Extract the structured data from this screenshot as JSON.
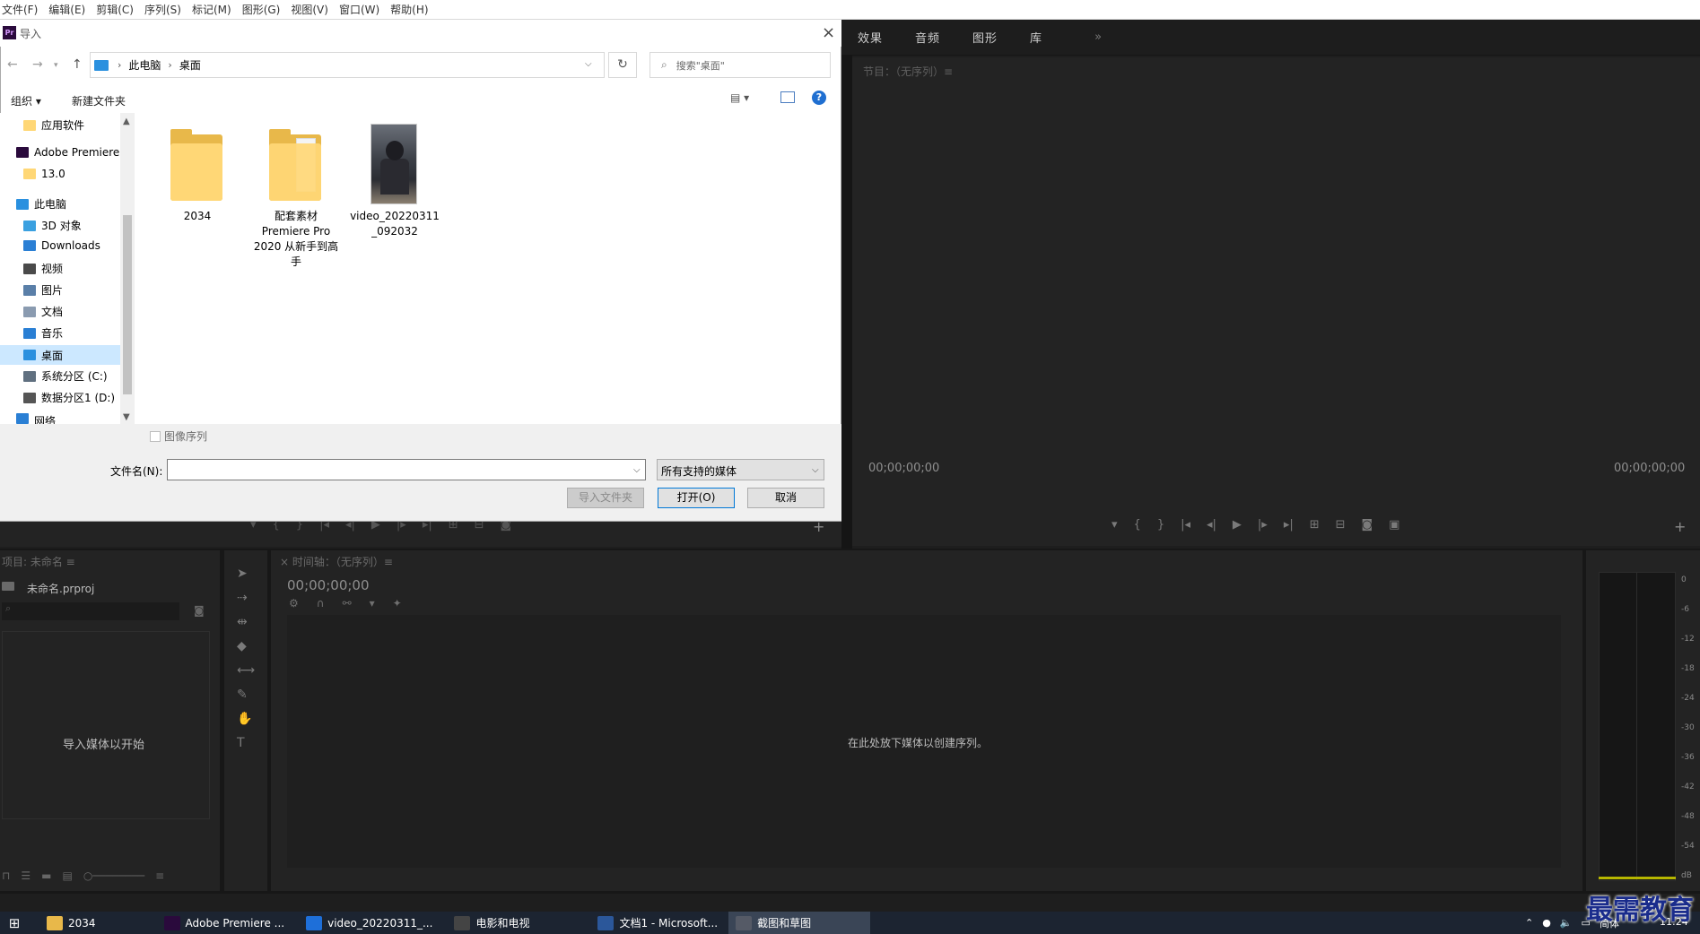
{
  "menubar": {
    "items": [
      "文件(F)",
      "编辑(E)",
      "剪辑(C)",
      "序列(S)",
      "标记(M)",
      "图形(G)",
      "视图(V)",
      "窗口(W)",
      "帮助(H)"
    ]
  },
  "premiere": {
    "right_tabs": [
      "效果",
      "音频",
      "图形",
      "库"
    ],
    "more_tabs": "»",
    "program_title": "节目：（无序列）≡",
    "program_tc_left": "00;00;00;00",
    "program_tc_right": "00;00;00;00",
    "plus": "+",
    "project_title": "项目: 未命名 ≡",
    "project_file": "未命名.prproj",
    "project_empty": "导入媒体以开始",
    "timeline_title": "×  时间轴：（无序列）≡",
    "timeline_tc": "00;00;00;00",
    "timeline_empty": "在此处放下媒体以创建序列。",
    "meter_db": [
      "0",
      "-6",
      "-12",
      "-18",
      "-24",
      "-30",
      "-36",
      "-42",
      "-48",
      "-54",
      "dB"
    ]
  },
  "dialog": {
    "title": "导入",
    "app_logo": "Pr",
    "close": "×",
    "address": {
      "crumbs": [
        "此电脑",
        "桌面"
      ],
      "sep": "›",
      "refresh": "↻"
    },
    "search": {
      "placeholder": "搜索\"桌面\""
    },
    "toolbar": {
      "organize": "组织 ▾",
      "new_folder": "新建文件夹",
      "view": "▤ ▾",
      "help": "?"
    },
    "nav": [
      {
        "label": "应用软件",
        "icon": "folder-icon",
        "color": "#ffd776"
      },
      {
        "label": "Adobe Premiere",
        "icon": "premiere-icon",
        "color": "#2a0a3c"
      },
      {
        "label": "13.0",
        "icon": "folder-icon",
        "color": "#ffd776"
      },
      {
        "label": "此电脑",
        "icon": "pc-icon",
        "color": "#2a90df"
      },
      {
        "label": "3D 对象",
        "icon": "3d-objects-icon",
        "color": "#3aa0e0"
      },
      {
        "label": "Downloads",
        "icon": "download-icon",
        "color": "#2a7fd4"
      },
      {
        "label": "视频",
        "icon": "video-icon",
        "color": "#4a4a4a"
      },
      {
        "label": "图片",
        "icon": "pictures-icon",
        "color": "#5a7fa8"
      },
      {
        "label": "文档",
        "icon": "documents-icon",
        "color": "#8a9bb0"
      },
      {
        "label": "音乐",
        "icon": "music-icon",
        "color": "#2a7fd4"
      },
      {
        "label": "桌面",
        "icon": "desktop-icon",
        "color": "#2a90df"
      },
      {
        "label": "系统分区 (C:)",
        "icon": "drive-icon",
        "color": "#607080"
      },
      {
        "label": "数据分区1 (D:)",
        "icon": "drive-icon",
        "color": "#555555"
      },
      {
        "label": "网络",
        "icon": "network-icon",
        "color": "#2a7fd4"
      }
    ],
    "files": [
      {
        "name": "2034"
      },
      {
        "name": "配套素材 Premiere Pro 2020 从新手到高手"
      },
      {
        "name": "video_20220311_092032"
      }
    ],
    "image_sequence": "图像序列",
    "filename_label": "文件名(N):",
    "filename_value": "",
    "filetype": "所有支持的媒体",
    "buttons": {
      "import_folder": "导入文件夹",
      "open": "打开(O)",
      "cancel": "取消"
    }
  },
  "taskbar": {
    "items": [
      {
        "label": "2034",
        "color": "#e8b84a"
      },
      {
        "label": "Adobe Premiere ...",
        "color": "#2a0a3c"
      },
      {
        "label": "video_20220311_...",
        "color": "#1e6fd9"
      },
      {
        "label": "电影和电视",
        "color": "#444444"
      },
      {
        "label": "文档1 - Microsoft...",
        "color": "#2b579a"
      },
      {
        "label": "截图和草图",
        "color": "#555a66"
      }
    ],
    "tray_ime": "简体",
    "time": "11:24"
  },
  "watermark": "最需教育"
}
